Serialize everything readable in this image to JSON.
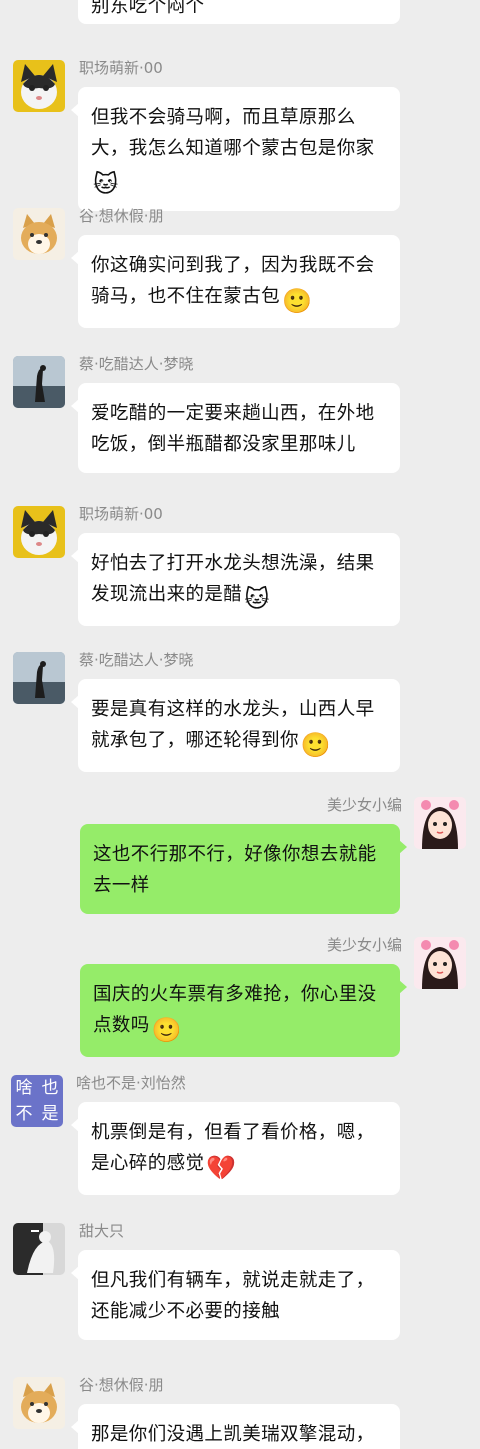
{
  "top_fragment": {
    "text": "别东吃个闷个"
  },
  "messages": [
    {
      "side": "left",
      "sender": "职场萌新·00",
      "avatar": "cat-avatar",
      "text": "但我不会骑马啊，而且草原那么大，我怎么知道哪个蒙古包是你家",
      "emoji": "🐱"
    },
    {
      "side": "left",
      "sender": "谷·想休假·朋",
      "avatar": "shiba-avatar",
      "text": "你这确实问到我了，因为我既不会骑马，也不住在蒙古包",
      "emoji": "🙂"
    },
    {
      "side": "left",
      "sender": "蔡·吃醋达人·梦晓",
      "avatar": "silhouette-avatar",
      "text": "爱吃醋的一定要来趟山西，在外地吃饭，倒半瓶醋都没家里那味儿",
      "emoji": ""
    },
    {
      "side": "left",
      "sender": "职场萌新·00",
      "avatar": "cat-avatar",
      "text": "好怕去了打开水龙头想洗澡，结果发现流出来的是醋",
      "emoji": "🐱"
    },
    {
      "side": "left",
      "sender": "蔡·吃醋达人·梦晓",
      "avatar": "silhouette-avatar",
      "text": "要是真有这样的水龙头，山西人早就承包了，哪还轮得到你",
      "emoji": "🙂"
    },
    {
      "side": "right",
      "sender": "美少女小编",
      "avatar": "girl-avatar",
      "text": "这也不行那不行，好像你想去就能去一样",
      "emoji": ""
    },
    {
      "side": "right",
      "sender": "美少女小编",
      "avatar": "girl-avatar",
      "text": "国庆的火车票有多难抢，你心里没点数吗",
      "emoji": "🙂"
    },
    {
      "side": "left",
      "sender": "啥也不是·刘怡然",
      "avatar": "text-avatar",
      "avatar_text": [
        "啥",
        "也",
        "不",
        "是"
      ],
      "text": "机票倒是有，但看了看价格，嗯，是心碎的感觉",
      "emoji": "💔"
    },
    {
      "side": "left",
      "sender": "甜大只",
      "avatar": "sketch-avatar",
      "text": "但凡我们有辆车，就说走就走了，还能减少不必要的接触",
      "emoji": ""
    },
    {
      "side": "left",
      "sender": "谷·想休假·朋",
      "avatar": "shiba-avatar",
      "text": "那是你们没遇上凯美瑞双擎混动，",
      "emoji": ""
    }
  ],
  "colors": {
    "background": "#ededed",
    "bubble_left": "#ffffff",
    "bubble_right": "#95ec69",
    "name": "#8a8a8a"
  }
}
